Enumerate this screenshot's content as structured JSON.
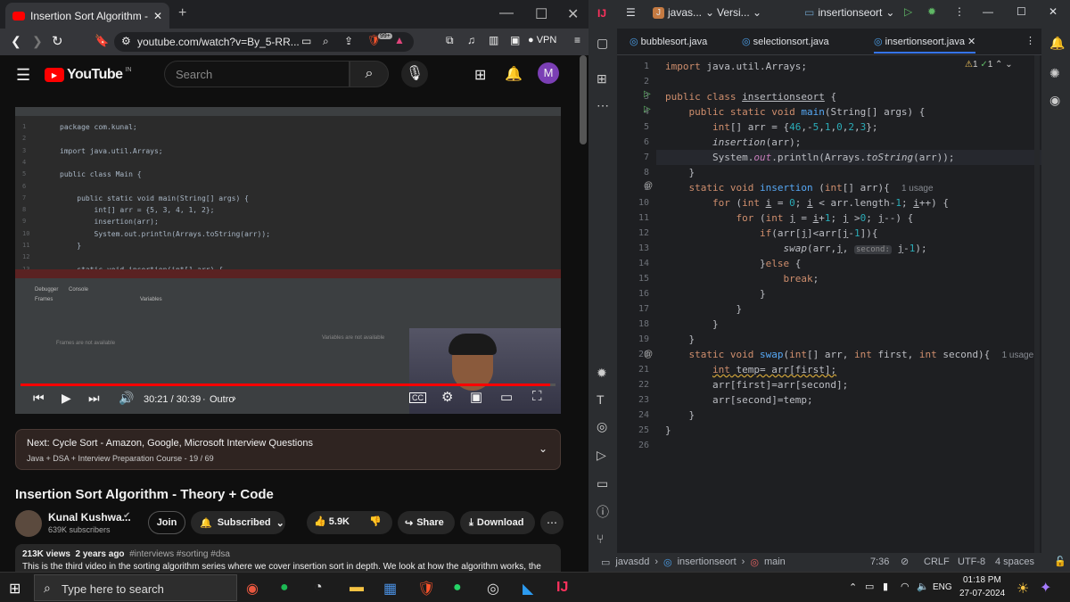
{
  "browser": {
    "tab_title": "Insertion Sort Algorithm - Theo",
    "url": "youtube.com/watch?v=By_5-RR...",
    "vpn": "VPN",
    "badge": "99+"
  },
  "youtube": {
    "logo": "YouTube",
    "country": "IN",
    "search_placeholder": "Search",
    "avatar_letter": "M",
    "player": {
      "time": "30:21 / 30:39",
      "chapter": "Outro",
      "progress": 0.99
    },
    "next": {
      "title": "Next: Cycle Sort - Amazon, Google, Microsoft Interview Questions",
      "sub": "Java + DSA + Interview Preparation Course - 19 / 69"
    },
    "video_title": "Insertion Sort Algorithm - Theory + Code",
    "channel": {
      "name": "Kunal Kushwa...",
      "subs": "639K subscribers"
    },
    "join": "Join",
    "subscribed": "Subscribed",
    "likes": "5.9K",
    "share": "Share",
    "download": "Download",
    "desc": {
      "views": "213K views",
      "age": "2 years ago",
      "tags": "#interviews #sorting #dsa",
      "text": "This is the third video in the sorting algorithm series where we cover insertion sort in depth. We look at how the algorithm works, the"
    },
    "vcode": {
      "lines": [
        "package com.kunal;",
        "",
        "import java.util.Arrays;",
        "",
        "public class Main {",
        "",
        "    public static void main(String[] args) {",
        "        int[] arr = {5, 3, 4, 1, 2};",
        "        insertion(arr);",
        "        System.out.println(Arrays.toString(arr));",
        "    }",
        "",
        "    static void insertion(int[] arr) {"
      ],
      "nums": [
        "1",
        "2",
        "3",
        "4",
        "5",
        "6",
        "7",
        "8",
        "9",
        "10",
        "11",
        "12",
        "13"
      ],
      "debug_tab": "Debugger",
      "console_tab": "Console",
      "frames": "Frames",
      "variables": "Variables",
      "frames_na": "Frames are not available",
      "vars_na": "Variables are not available",
      "main_tab": "Main"
    }
  },
  "ide": {
    "project": "javas...",
    "vcs": "Versi...",
    "run_config": "insertionseort",
    "tabs": [
      "bubblesort.java",
      "selectionsort.java",
      "insertionseort.java"
    ],
    "warnings": "1",
    "checks": "1",
    "line_numbers": [
      "1",
      "2",
      "3",
      "4",
      "5",
      "6",
      "7",
      "8",
      "9",
      "10",
      "11",
      "12",
      "13",
      "14",
      "15",
      "16",
      "17",
      "18",
      "19",
      "20",
      "21",
      "22",
      "23",
      "24",
      "25",
      "26"
    ],
    "usage1": "1 usage",
    "usage2": "1 usage",
    "hint": "second:",
    "status": {
      "project": "javasdd",
      "file": "insertionseort",
      "method": "main",
      "pos": "7:36",
      "eol": "CRLF",
      "enc": "UTF-8",
      "indent": "4 spaces"
    }
  },
  "taskbar": {
    "search": "Type here to search",
    "lang": "ENG",
    "time": "01:18 PM",
    "date": "27-07-2024"
  },
  "colors": {
    "yt_red": "#ff0000",
    "ide_bg": "#1e1f22",
    "accent": "#3574f0"
  }
}
